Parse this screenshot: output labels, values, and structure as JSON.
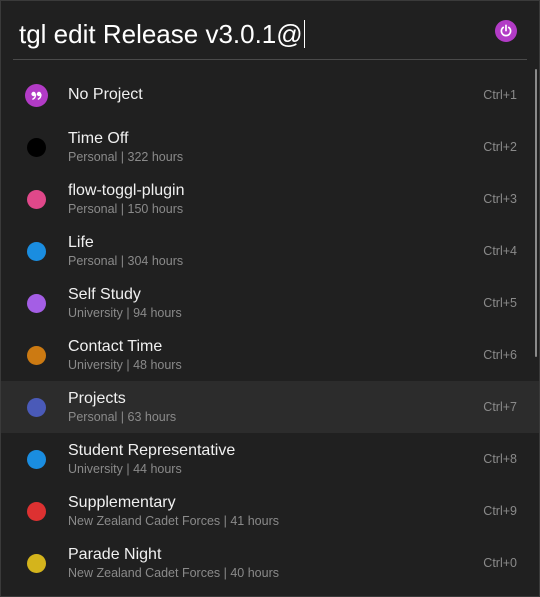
{
  "search": {
    "query": "tgl edit Release v3.0.1@"
  },
  "plugin": {
    "icon": "toggl-power-icon",
    "color": "#b23bc6"
  },
  "results": [
    {
      "title": "No Project",
      "subtitle": "",
      "hotkey": "Ctrl+1",
      "color": "#b23bc6",
      "icon": "quote-icon",
      "selected": false
    },
    {
      "title": "Time Off",
      "subtitle": "Personal | 322 hours",
      "hotkey": "Ctrl+2",
      "color": "#000000",
      "selected": false
    },
    {
      "title": "flow-toggl-plugin",
      "subtitle": "Personal | 150 hours",
      "hotkey": "Ctrl+3",
      "color": "#e0488a",
      "selected": false
    },
    {
      "title": "Life",
      "subtitle": "Personal | 304 hours",
      "hotkey": "Ctrl+4",
      "color": "#1a8de0",
      "selected": false
    },
    {
      "title": "Self Study",
      "subtitle": "University | 94 hours",
      "hotkey": "Ctrl+5",
      "color": "#a45ee5",
      "selected": false
    },
    {
      "title": "Contact Time",
      "subtitle": "University | 48 hours",
      "hotkey": "Ctrl+6",
      "color": "#cc7a12",
      "selected": false
    },
    {
      "title": "Projects",
      "subtitle": "Personal | 63 hours",
      "hotkey": "Ctrl+7",
      "color": "#4a5ab8",
      "selected": true
    },
    {
      "title": "Student Representative",
      "subtitle": "University | 44 hours",
      "hotkey": "Ctrl+8",
      "color": "#1a8de0",
      "selected": false
    },
    {
      "title": "Supplementary",
      "subtitle": "New Zealand Cadet Forces | 41 hours",
      "hotkey": "Ctrl+9",
      "color": "#dd3131",
      "selected": false
    },
    {
      "title": "Parade Night",
      "subtitle": "New Zealand Cadet Forces | 40 hours",
      "hotkey": "Ctrl+0",
      "color": "#d4b41c",
      "selected": false
    }
  ]
}
